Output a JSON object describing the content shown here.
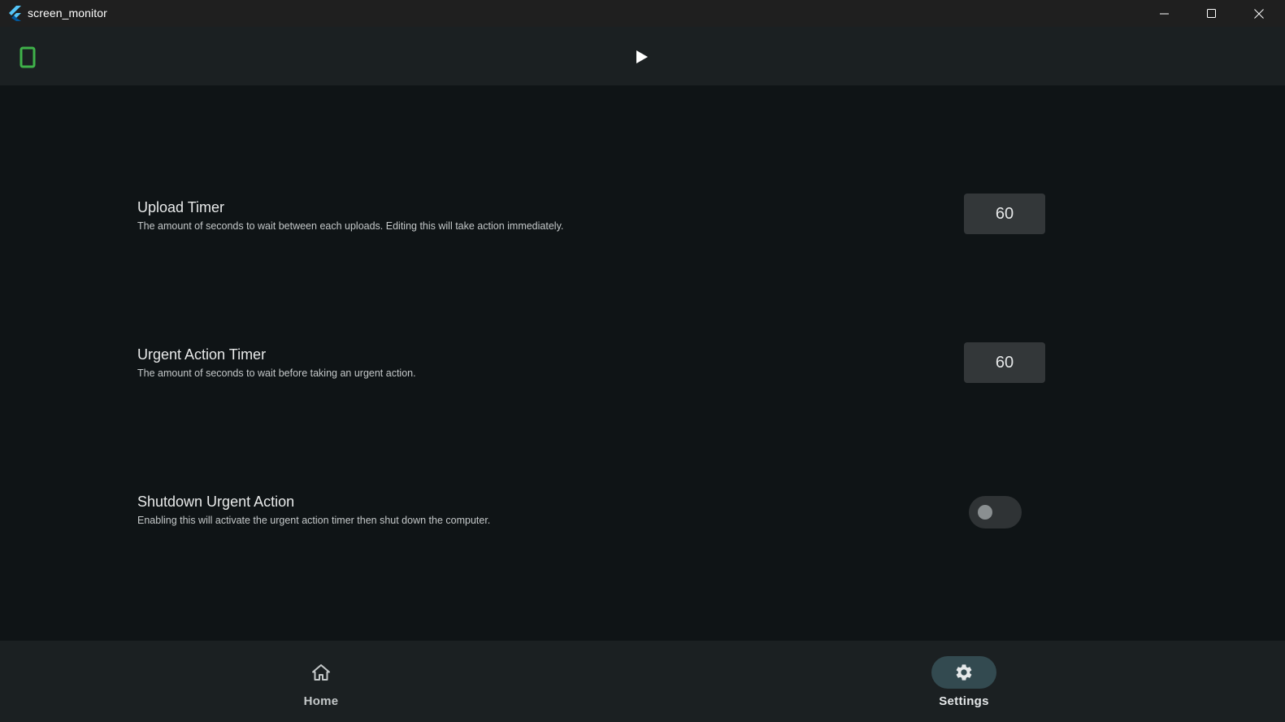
{
  "window": {
    "title": "screen_monitor",
    "controls": [
      "minimize",
      "maximize",
      "close"
    ]
  },
  "appbar": {
    "left_icon": "smartphone-icon",
    "center_icon": "play-icon",
    "accent_color": "#3fb24a"
  },
  "settings": [
    {
      "title": "Upload Timer",
      "description": "The amount of seconds to wait between each uploads. Editing this will take action immediately.",
      "value": "60"
    },
    {
      "title": "Urgent Action Timer",
      "description": "The amount of seconds to wait before taking an urgent action.",
      "value": "60"
    },
    {
      "title": "Shutdown Urgent Action",
      "description": "Enabling this will activate the urgent action timer then shut down the computer.",
      "enabled": false
    }
  ],
  "nav": {
    "items": [
      {
        "label": "Home",
        "icon": "home-icon",
        "active": false
      },
      {
        "label": "Settings",
        "icon": "gear-icon",
        "active": true
      }
    ]
  }
}
